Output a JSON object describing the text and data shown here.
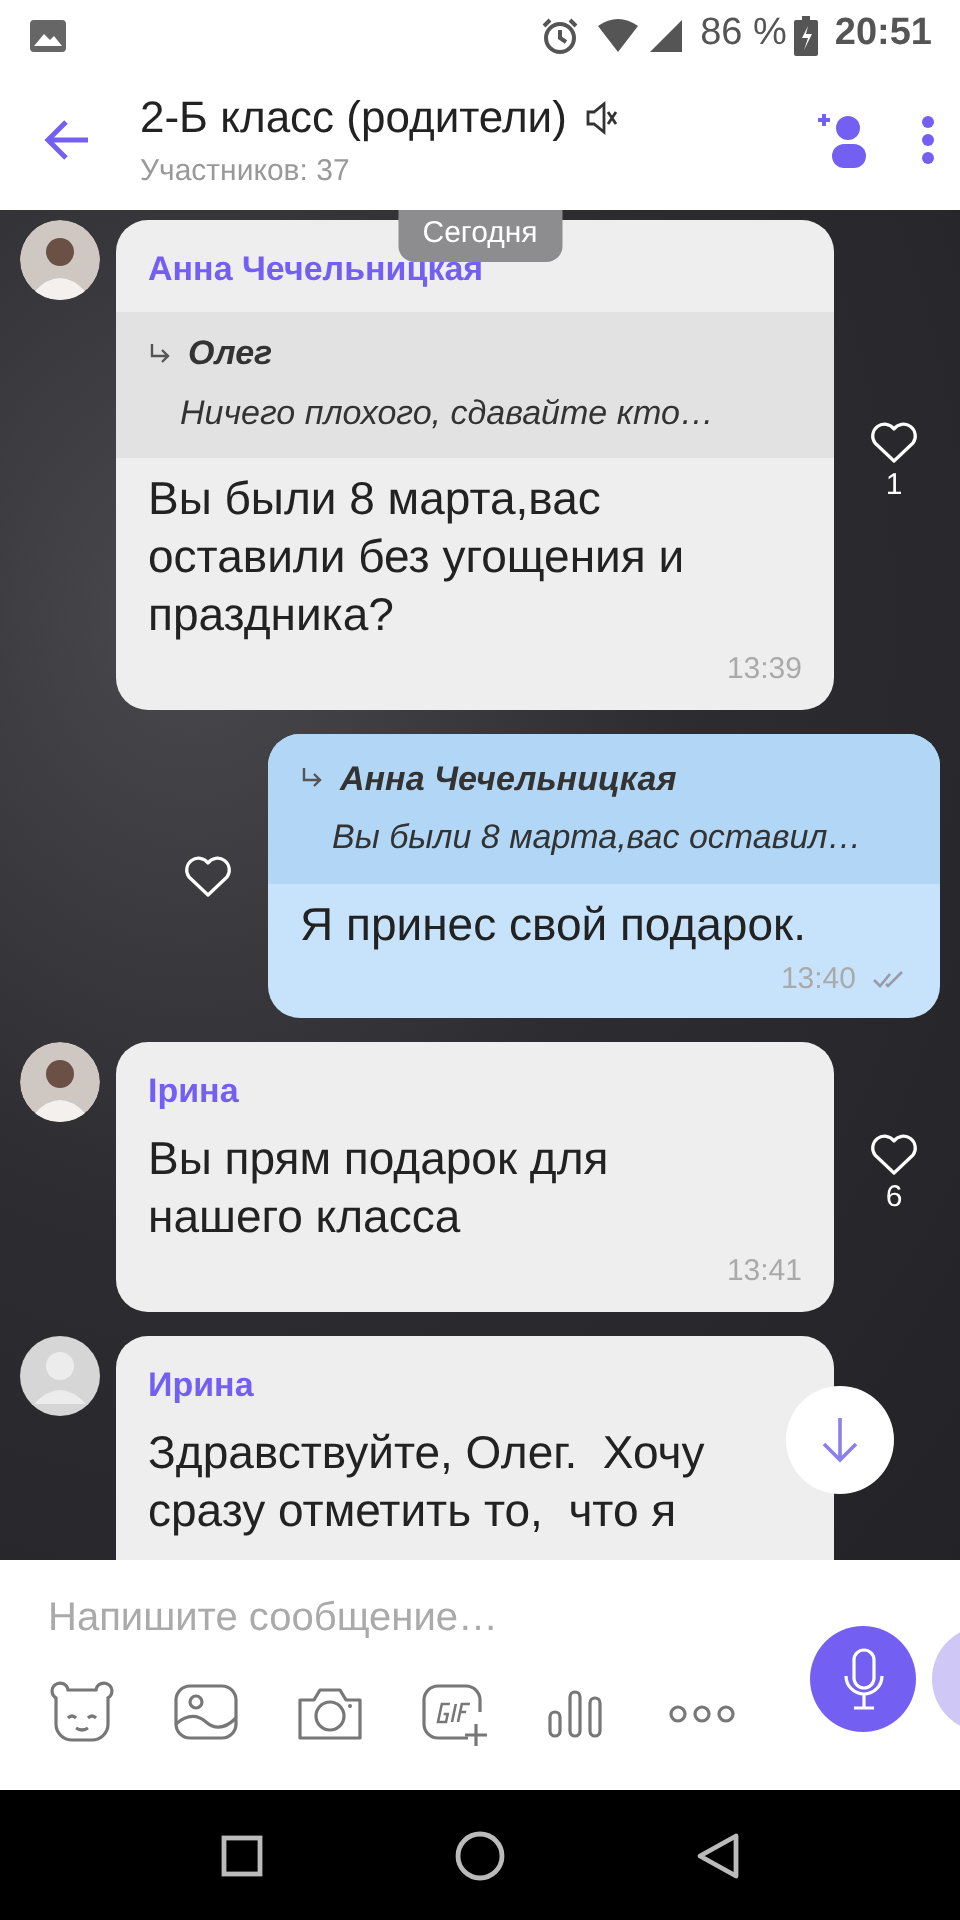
{
  "status_bar": {
    "battery": "86 %",
    "time": "20:51"
  },
  "header": {
    "title": "2-Б класс (родители)",
    "muted": true,
    "subtitle": "Участников: 37"
  },
  "date_label": "Сегодня",
  "messages": [
    {
      "outgoing": false,
      "avatar_photo": true,
      "sender": "Анна Чечельницкая",
      "reply": {
        "author": "Олег",
        "text": "Ничего плохого, сдавайте кто…"
      },
      "text": "Вы были 8 марта,вас оставили без угощения и праздника?",
      "time": "13:39",
      "likes": "1"
    },
    {
      "outgoing": true,
      "reply": {
        "author": "Анна Чечельницкая",
        "text": "Вы были 8 марта,вас оставил…"
      },
      "text": "Я принес свой подарок.",
      "time": "13:40",
      "read": true
    },
    {
      "outgoing": false,
      "avatar_photo": true,
      "sender": "Ірина",
      "text": "Вы прям подарок для нашего класса",
      "time": "13:41",
      "likes": "6"
    },
    {
      "outgoing": false,
      "avatar_photo": false,
      "sender": "Ирина",
      "text": "Здравствуйте, Олег.  Хочу сразу отметить то,  что я"
    }
  ],
  "composer": {
    "placeholder": "Напишите сообщение…"
  }
}
